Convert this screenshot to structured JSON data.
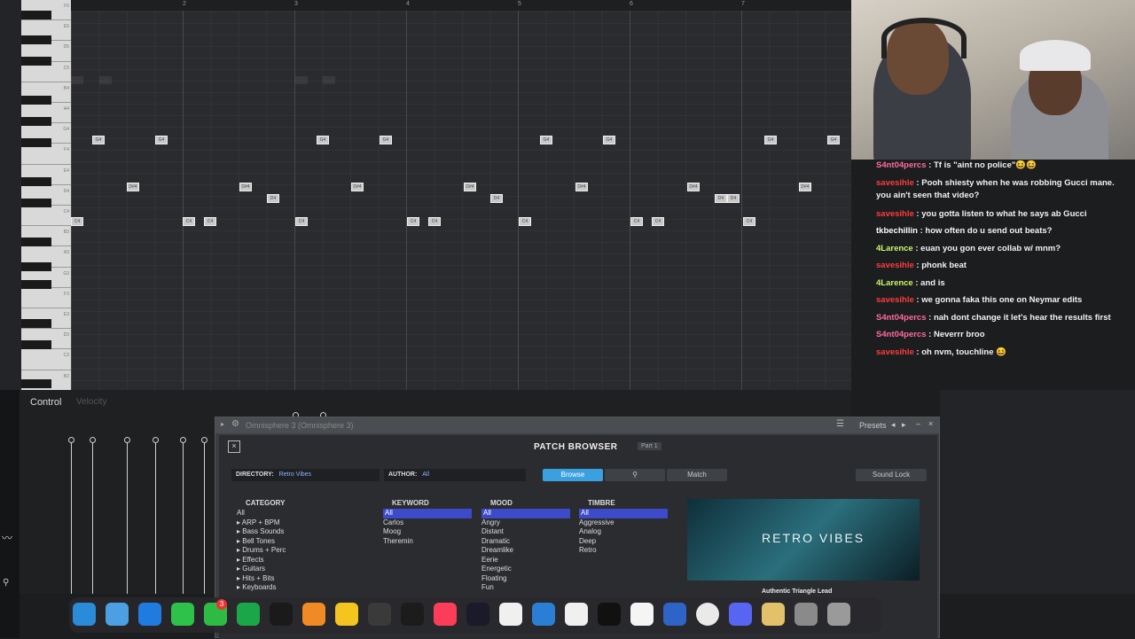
{
  "piano_roll": {
    "bar_numbers": [
      "2",
      "3",
      "4",
      "5",
      "6",
      "7"
    ],
    "key_labels": [
      "F5",
      "E5",
      "D5",
      "C5",
      "B4",
      "A4",
      "G4",
      "F4",
      "E4",
      "D4",
      "C4",
      "B3",
      "A3",
      "G3",
      "F3",
      "E3",
      "D3",
      "C3",
      "B2"
    ],
    "notes": [
      {
        "label": "G4"
      },
      {
        "label": "G4"
      },
      {
        "label": "G4"
      },
      {
        "label": "G4"
      },
      {
        "label": "G4"
      },
      {
        "label": "G4"
      },
      {
        "label": "G4"
      },
      {
        "label": "G4"
      },
      {
        "label": "D#4"
      },
      {
        "label": "D#4"
      },
      {
        "label": "D#4"
      },
      {
        "label": "D#4"
      },
      {
        "label": "D#4"
      },
      {
        "label": "D#4"
      },
      {
        "label": "D#4"
      },
      {
        "label": "D#4"
      },
      {
        "label": "D4"
      },
      {
        "label": "D4"
      },
      {
        "label": "D4"
      },
      {
        "label": "D4"
      },
      {
        "label": "C4"
      },
      {
        "label": "C4"
      },
      {
        "label": "C4"
      },
      {
        "label": "C4"
      },
      {
        "label": "C4"
      },
      {
        "label": "C4"
      },
      {
        "label": "C4"
      },
      {
        "label": "C4"
      },
      {
        "label": "C4"
      },
      {
        "label": "C4"
      },
      {
        "label": "C4"
      },
      {
        "label": "C4"
      }
    ]
  },
  "control": {
    "label": "Control",
    "sub_label": "Velocity"
  },
  "chat": [
    {
      "user": "S4nt04percs",
      "msg": ": Tf is \"aint no police\"😆😆",
      "color": "#ff6b9a"
    },
    {
      "user": "savesihle",
      "msg": ": Pooh shiesty when he was robbing Gucci mane. you ain't seen that video?",
      "color": "#ff3b3b"
    },
    {
      "user": "savesihle",
      "msg": ": you gotta listen to what he says ab Gucci",
      "color": "#ff3b3b"
    },
    {
      "user": "tkbechillin",
      "msg": ": how often do u send out beats?",
      "color": "#ffffff"
    },
    {
      "user": "4Larence",
      "msg": ": euan you gon ever collab w/ mnm?",
      "color": "#c8f56a"
    },
    {
      "user": "savesihle",
      "msg": ": phonk beat",
      "color": "#ff3b3b"
    },
    {
      "user": "4Larence",
      "msg": ": and is",
      "color": "#c8f56a"
    },
    {
      "user": "savesihle",
      "msg": ": we gonna faka this one on Neymar edits",
      "color": "#ff3b3b"
    },
    {
      "user": "S4nt04percs",
      "msg": ": nah dont change it let's hear the results first",
      "color": "#ff6b9a"
    },
    {
      "user": "S4nt04percs",
      "msg": ": Neverrr broo",
      "color": "#ff6b9a"
    },
    {
      "user": "savesihle",
      "msg": ": oh nvm, touchline 😆",
      "color": "#ff3b3b"
    }
  ],
  "plugin": {
    "title": "Omnisphere 3 (Omnisphere 3)",
    "presets_label": "Presets",
    "header": "PATCH BROWSER",
    "part": "Part 1",
    "directory_label": "DIRECTORY:",
    "directory_value": "Retro Vibes",
    "author_label": "AUTHOR:",
    "author_value": "All",
    "browse_btn": "Browse",
    "match_btn": "Match",
    "sound_lock": "Sound Lock",
    "category_head": "CATEGORY",
    "categories": [
      "All",
      "ARP + BPM",
      "Bass Sounds",
      "Bell Tones",
      "Drums + Perc",
      "Effects",
      "Guitars",
      "Hits + Bits",
      "Keyboards"
    ],
    "keyword_head": "KEYWORD",
    "keywords": [
      "All",
      "Carlos",
      "Moog",
      "Theremin"
    ],
    "mood_head": "MOOD",
    "moods": [
      "All",
      "Angry",
      "Distant",
      "Dramatic",
      "Dreamlike",
      "Eerie",
      "Energetic",
      "Floating",
      "Fun"
    ],
    "timbre_head": "TIMBRE",
    "timbres": [
      "All",
      "Aggressive",
      "Analog",
      "Deep",
      "Retro"
    ],
    "artwork_title": "RETRO VIBES",
    "patch_name": "Authentic Triangle Lead"
  },
  "dock": {
    "icons": [
      "finder",
      "files",
      "safari",
      "messages",
      "facetime",
      "kite",
      "obs",
      "fl-studio",
      "notes",
      "unknown-app",
      "tradingview",
      "music",
      "davinci",
      "github",
      "vscode",
      "chatgpt",
      "capcut",
      "notion",
      "box-app",
      "chrome",
      "discord",
      "keychain",
      "settings",
      "trash"
    ],
    "badge": "3"
  }
}
